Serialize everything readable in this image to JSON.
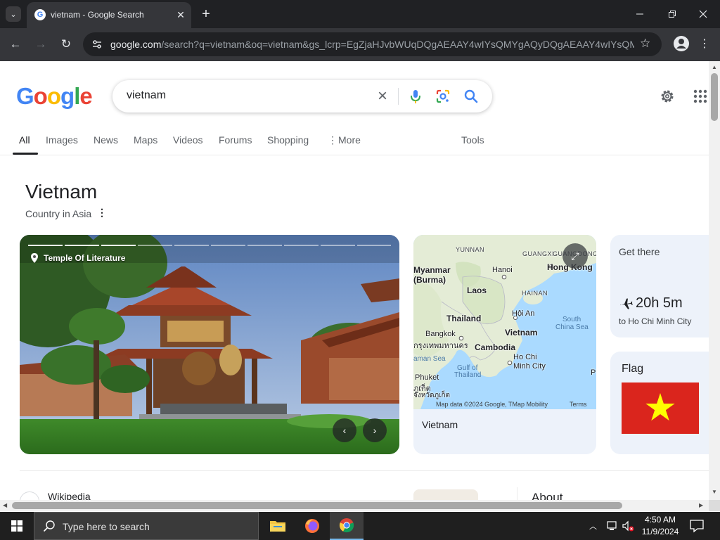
{
  "browser": {
    "tab_title": "vietnam - Google Search",
    "url_host": "google.com",
    "url_rest": "/search?q=vietnam&oq=vietnam&gs_lcrp=EgZjaHJvbWUqDQgAEAAY4wIYsQMYgAQyDQgAEAAY4wIYsQM..."
  },
  "search": {
    "logo": [
      "G",
      "o",
      "o",
      "g",
      "l",
      "e"
    ],
    "logo_colors": [
      "#4285f4",
      "#ea4335",
      "#fbbc05",
      "#4285f4",
      "#34a853",
      "#ea4335"
    ],
    "query": "vietnam",
    "tabs": [
      "All",
      "Images",
      "News",
      "Maps",
      "Videos",
      "Forums",
      "Shopping",
      "More",
      "Tools"
    ]
  },
  "knowledge_panel": {
    "title": "Vietnam",
    "subtitle": "Country in Asia",
    "hero_caption": "Temple Of Literature",
    "carousel_segments": 10,
    "map": {
      "label": "Vietnam",
      "attribution": "Map data ©2024 Google, TMap Mobility",
      "terms": "Terms",
      "places": {
        "yunnan": "YUNNAN",
        "guangxi": "GUANGXI",
        "guangdong": "GUANGDONG",
        "myanmar": "Myanmar",
        "burma": "(Burma)",
        "hanoi": "Hanoi",
        "hong_kong": "Hong Kong",
        "laos": "Laos",
        "hainan": "HAINAN",
        "hoi_an": "Hội An",
        "thailand": "Thailand",
        "vietnam": "Vietnam",
        "south_china_sea": "South",
        "south_china_sea_2": "China Sea",
        "bangkok": "Bangkok",
        "bangkok_thai": "กรุงเทพมหานคร",
        "cambodia": "Cambodia",
        "andaman_sea": "aman Sea",
        "gulf_1": "Gulf of",
        "gulf_2": "Thailand",
        "ho_chi_minh_1": "Ho Chi",
        "ho_chi_minh_2": "Minh City",
        "phuket": "Phuket",
        "phuket_thai": "ภูเก็ต",
        "phuket_thai_province": "จังหวัดภูเก็ต",
        "edge_p": "P"
      }
    },
    "get_there": {
      "title": "Get there",
      "time": "20h 5m",
      "destination": "to Ho Chi Minh City"
    },
    "flag": {
      "title": "Flag",
      "field_color": "#da251d",
      "star_color": "#ffff00"
    }
  },
  "results": {
    "first_source": "Wikipedia",
    "about_label": "About"
  },
  "taskbar": {
    "search_placeholder": "Type here to search",
    "time": "4:50 AM",
    "date": "11/9/2024"
  }
}
